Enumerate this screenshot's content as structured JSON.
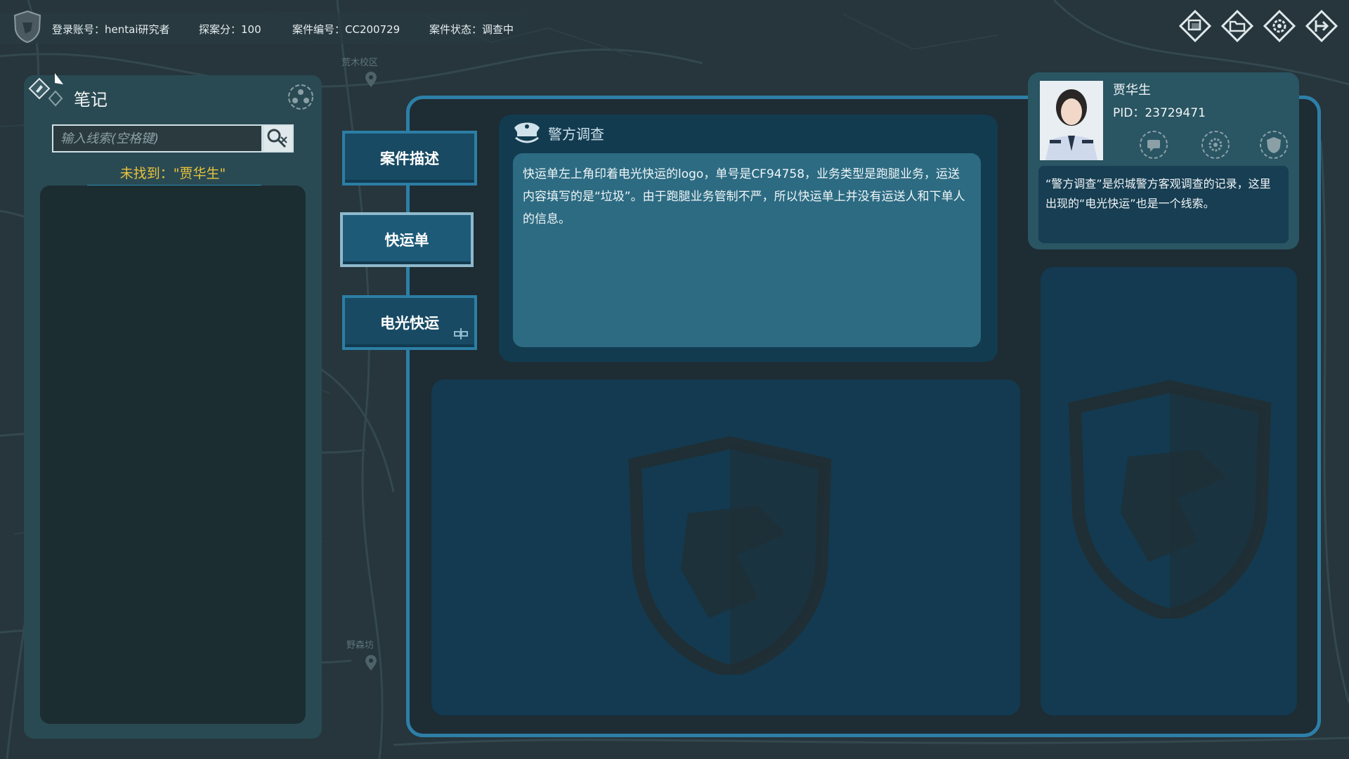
{
  "topbar": {
    "account": "登录账号：hentai研究者",
    "score": "探案分：100",
    "case_no": "案件编号：CC200729",
    "case_status": "案件状态：调查中"
  },
  "top_icons": [
    "window-icon",
    "folder-icon",
    "settings-icon",
    "exit-icon"
  ],
  "notes": {
    "title": "笔记",
    "search_placeholder": "输入线索(空格键)",
    "not_found": "未找到：\"贾华生\""
  },
  "tabs": [
    {
      "label": "案件描述",
      "active": false
    },
    {
      "label": "快运单",
      "active": true
    },
    {
      "label": "电光快运",
      "active": false
    }
  ],
  "police": {
    "title": "警方调查",
    "content": "快运单左上角印着电光快运的logo，单号是CF94758，业务类型是跑腿业务，运送内容填写的是“垃圾”。由于跑腿业务管制不严，所以快运单上并没有运送人和下单人的信息。"
  },
  "profile": {
    "name": "贾华生",
    "pid": "PID：23729471",
    "desc": "“警方调查”是炽城警方客观调查的记录，这里出现的“电光快运”也是一个线索。",
    "icons": [
      "chat-icon",
      "gear-icon",
      "badge-icon"
    ]
  },
  "map_labels": {
    "top": "荒木校区",
    "bottom": "野森坊"
  },
  "colors": {
    "accent": "#2d7fa7",
    "panel": "#133a50",
    "warning": "#e8c33c"
  }
}
